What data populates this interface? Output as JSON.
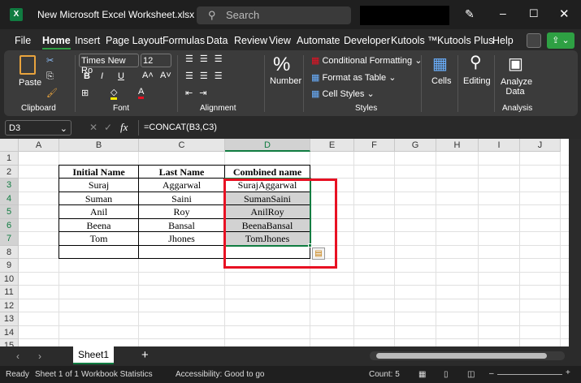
{
  "window": {
    "title": "New Microsoft Excel Worksheet.xlsx ⌄",
    "search_placeholder": "Search"
  },
  "menu": [
    "File",
    "Home",
    "Insert",
    "Page Layout",
    "Formulas",
    "Data",
    "Review",
    "View",
    "Automate",
    "Developer",
    "Kutools ™",
    "Kutools Plus",
    "Help"
  ],
  "ribbon": {
    "paste": "Paste",
    "font_name": "Times New Ro",
    "font_size": "12",
    "number": "Number",
    "conditional": "Conditional Formatting ⌄",
    "format_table": "Format as Table ⌄",
    "cell_styles": "Cell Styles ⌄",
    "cells": "Cells",
    "editing": "Editing",
    "analyze": "Analyze Data",
    "groups": [
      "Clipboard",
      "Font",
      "Alignment",
      "Styles",
      "Analysis"
    ]
  },
  "formula_bar": {
    "name_box": "D3",
    "fx": "fx",
    "formula": "=CONCAT(B3,C3)"
  },
  "columns": [
    "A",
    "B",
    "C",
    "D",
    "E",
    "F",
    "G",
    "H",
    "I",
    "J"
  ],
  "rows": [
    "1",
    "2",
    "3",
    "4",
    "5",
    "6",
    "7",
    "8",
    "9",
    "10",
    "11",
    "12",
    "13",
    "14",
    "15"
  ],
  "table": {
    "headers": [
      "Initial Name",
      "Last Name",
      "Combined name"
    ],
    "rows": [
      [
        "Suraj",
        "Aggarwal",
        "SurajAggarwal"
      ],
      [
        "Suman",
        "Saini",
        "SumanSaini"
      ],
      [
        "Anil",
        "Roy",
        "AnilRoy"
      ],
      [
        "Beena",
        "Bansal",
        "BeenaBansal"
      ],
      [
        "Tom",
        "Jhones",
        "TomJhones"
      ],
      [
        "",
        "",
        ""
      ]
    ]
  },
  "sheet_tab": "Sheet1",
  "status": {
    "ready": "Ready",
    "sheet": "Sheet 1 of 1",
    "stats": "Workbook Statistics",
    "accessibility": "Accessibility: Good to go",
    "count": "Count: 5"
  },
  "colors": {
    "accent": "#107c41",
    "highlight": "#e81123",
    "selection": "#d2d2d2"
  }
}
